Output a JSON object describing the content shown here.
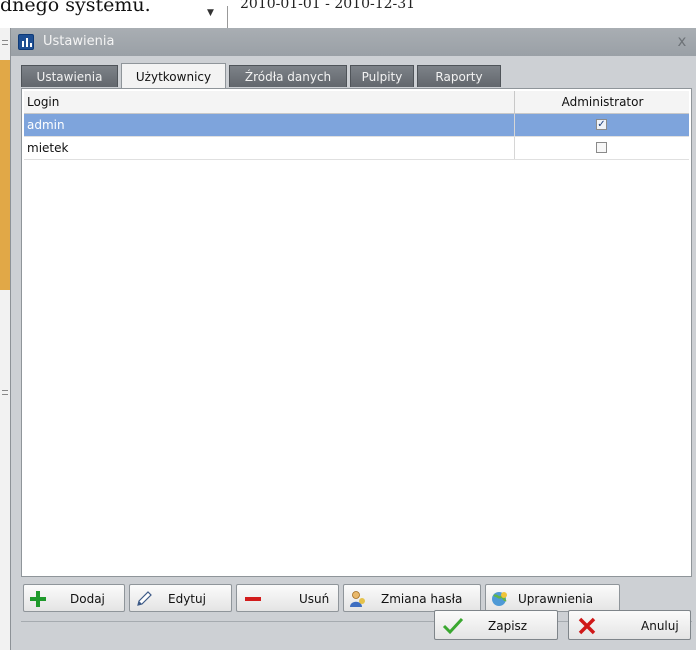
{
  "background": {
    "top_text": "dnego systemu.",
    "date_range": "2010-01-01 - 2010-12-31"
  },
  "window": {
    "title": "Ustawienia",
    "close": "x"
  },
  "tabs": [
    {
      "label": "Ustawienia",
      "active": false
    },
    {
      "label": "Użytkownicy",
      "active": true
    },
    {
      "label": "Źródła danych",
      "active": false
    },
    {
      "label": "Pulpity",
      "active": false
    },
    {
      "label": "Raporty",
      "active": false
    }
  ],
  "grid": {
    "columns": {
      "login": "Login",
      "admin": "Administrator"
    },
    "rows": [
      {
        "login": "admin",
        "administrator": true,
        "selected": true
      },
      {
        "login": "mietek",
        "administrator": false,
        "selected": false
      }
    ]
  },
  "toolbar": {
    "add": "Dodaj",
    "edit": "Edytuj",
    "delete": "Usuń",
    "change_password": "Zmiana hasła",
    "permissions": "Uprawnienia"
  },
  "footer": {
    "save": "Zapisz",
    "cancel": "Anuluj"
  },
  "colors": {
    "selection": "#7ea4dc",
    "add_icon": "#1f9a2c",
    "delete_icon": "#d21c1c",
    "save_icon": "#3aa830",
    "cancel_icon": "#d01818"
  }
}
